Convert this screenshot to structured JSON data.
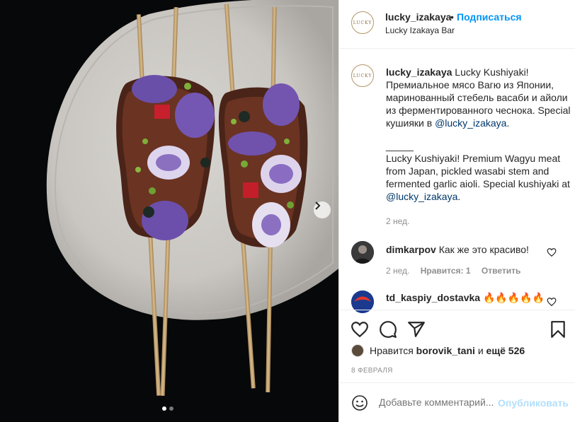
{
  "post": {
    "username": "lucky_izakaya",
    "separator": "•",
    "follow_label": "Подписаться",
    "location": "Lucky Izakaya Bar",
    "avatar_text": "LUCKY",
    "caption": {
      "username": "lucky_izakaya",
      "ru_text": "Lucky Kushiyaki! Премиальное мясо Вагю из Японии, маринованный стебель васаби и айоли из ферментированного чеснока. Special кушияки в",
      "ru_mention": "@lucky_izakaya",
      "ru_end": ".",
      "divider": "_____",
      "en_text": "Lucky Kushiyaki! Premium Wagyu meat from Japan, pickled wasabi stem and fermented garlic aioli. Special kushiyaki at",
      "en_mention": "@lucky_izakaya",
      "en_end": ".",
      "time": "2 нед."
    },
    "comments": [
      {
        "username": "dimkarpov",
        "text": "Как же это красиво!",
        "time": "2 нед.",
        "likes": "Нравится: 1",
        "reply": "Ответить"
      },
      {
        "username": "td_kaspiy_dostavka",
        "text": "🔥🔥🔥🔥🔥"
      }
    ],
    "likes": {
      "prefix": "Нравится",
      "user": "borovik_tani",
      "middle": "и",
      "more": "ещё 526"
    },
    "date": "8 ФЕВРАЛЯ",
    "composer": {
      "placeholder": "Добавьте комментарий...",
      "post_label": "Опубликовать"
    },
    "carousel": {
      "count": 2,
      "active": 1
    }
  },
  "colors": {
    "link": "#0095f6",
    "mention": "#00376b",
    "muted": "#8e8e8e",
    "post_disabled": "#b2dffc"
  },
  "icons": {
    "like": "heart-icon",
    "comment": "comment-icon",
    "share": "paper-plane-icon",
    "save": "bookmark-icon",
    "emoji": "smiley-icon",
    "next": "chevron-right-icon"
  }
}
